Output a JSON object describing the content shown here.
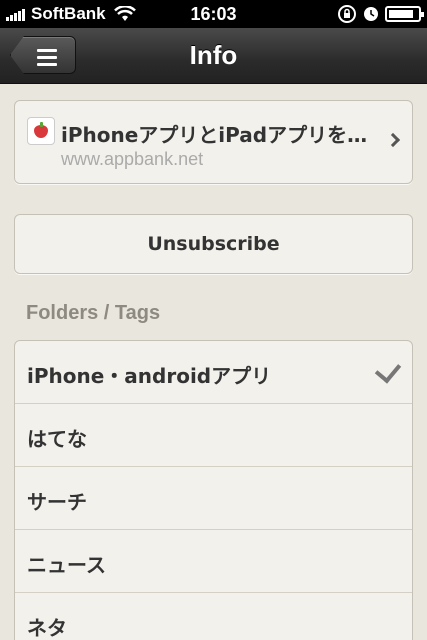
{
  "status_bar": {
    "carrier": "SoftBank",
    "time": "16:03",
    "icons": [
      "signal-icon",
      "wifi-icon",
      "rotation-lock-icon",
      "alarm-icon",
      "battery-icon"
    ]
  },
  "nav": {
    "title": "Info",
    "menu_icon": "menu-icon"
  },
  "feed": {
    "title": "iPhoneアプリとiPadアプリを…",
    "url": "www.appbank.net",
    "icon": "feed-favicon-icon"
  },
  "actions": {
    "unsubscribe": "Unsubscribe"
  },
  "folders": {
    "title": "Folders / Tags",
    "items": [
      {
        "label": "iPhone・androidアプリ",
        "checked": true
      },
      {
        "label": "はてな",
        "checked": false
      },
      {
        "label": "サーチ",
        "checked": false
      },
      {
        "label": "ニュース",
        "checked": false
      },
      {
        "label": "ネタ",
        "checked": false
      }
    ]
  },
  "colors": {
    "background": "#e9e6dd",
    "navbar": "#2b2b2b",
    "card": "#f3f1ec"
  }
}
